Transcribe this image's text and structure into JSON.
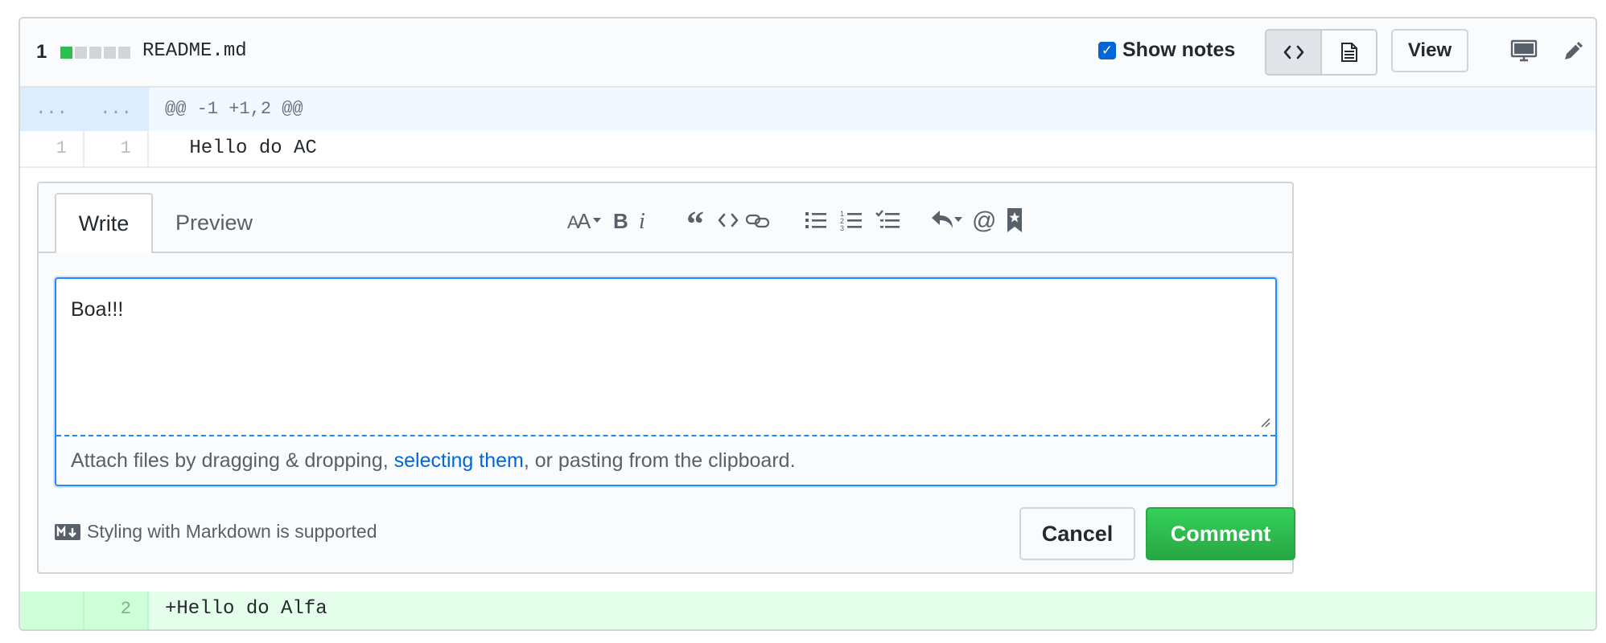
{
  "file_header": {
    "changes_count": "1",
    "diffstat_colors": [
      "#2cbe4e",
      "#d1d5da",
      "#d1d5da",
      "#d1d5da",
      "#d1d5da"
    ],
    "file_name": "README.md",
    "show_notes_checked": true,
    "show_notes_label": "Show notes",
    "code_view_icon": "code-icon",
    "rich_view_icon": "file-text-icon",
    "view_label": "View",
    "desktop_icon": "desktop-icon",
    "edit_icon": "pencil-icon"
  },
  "diff": {
    "hunk": {
      "old_num": "...",
      "new_num": "...",
      "header": "@@ -1 +1,2 @@"
    },
    "context_line": {
      "old_num": "1",
      "new_num": "1",
      "code": " Hello do AC"
    },
    "added_line": {
      "old_num": "",
      "new_num": "2",
      "code": "+Hello do Alfa"
    }
  },
  "comment_form": {
    "tab_write": "Write",
    "tab_preview": "Preview",
    "toolbar_icons": [
      "text-size-icon",
      "bold-icon",
      "italic-icon",
      "quote-icon",
      "code-icon",
      "link-icon",
      "unordered-list-icon",
      "ordered-list-icon",
      "task-list-icon",
      "reply-icon",
      "mention-icon",
      "bookmark-icon"
    ],
    "textarea_value": "Boa!!!",
    "attach_prefix": "Attach files by dragging & dropping, ",
    "attach_link": "selecting them",
    "attach_suffix": ", or pasting from the clipboard.",
    "markdown_hint": "Styling with Markdown is supported",
    "cancel_label": "Cancel",
    "comment_label": "Comment"
  },
  "colors": {
    "accent_blue": "#0366d6",
    "addition_bg": "#e6ffed",
    "hunk_bg": "#f1f8ff",
    "comment_green": "#28a745"
  }
}
